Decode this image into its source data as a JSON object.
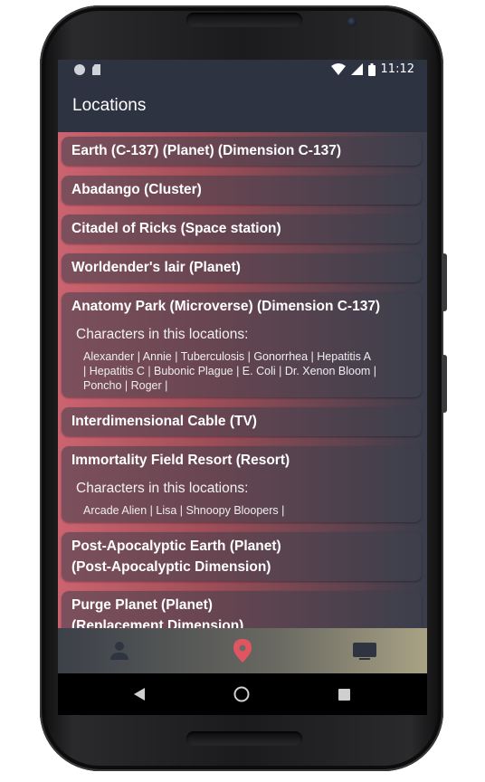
{
  "status_bar": {
    "time": "11:12"
  },
  "app_bar": {
    "title": "Locations"
  },
  "locations": [
    {
      "name": "Earth (C-137)  (Planet)  (Dimension C-137)"
    },
    {
      "name": "Abadango  (Cluster)"
    },
    {
      "name": "Citadel of Ricks  (Space station)"
    },
    {
      "name": "Worldender's lair  (Planet)"
    },
    {
      "name": "Anatomy Park  (Microverse)  (Dimension C-137)",
      "characters_heading": "Characters in this locations:",
      "characters_line1": "Alexander | Annie | Tuberculosis | Gonorrhea | Hepatitis A",
      "characters_line2": "| Hepatitis C | Bubonic Plague | E. Coli | Dr. Xenon Bloom |",
      "characters_line3": "Poncho | Roger |"
    },
    {
      "name": "Interdimensional Cable  (TV)"
    },
    {
      "name": "Immortality Field Resort  (Resort)",
      "characters_heading": "Characters in this locations:",
      "characters_line1": "Arcade Alien | Lisa | Shnoopy Bloopers |"
    },
    {
      "name_line1": "Post-Apocalyptic Earth  (Planet)",
      "name_line2": "(Post-Apocalyptic Dimension)"
    },
    {
      "name_line1": "Purge Planet  (Planet)",
      "name_line2": "(Replacement Dimension)"
    }
  ],
  "bottom_nav": {
    "items": [
      {
        "icon": "person-icon",
        "active": false
      },
      {
        "icon": "location-pin-icon",
        "active": true
      },
      {
        "icon": "tv-icon",
        "active": false
      }
    ],
    "active_color": "#e05561",
    "inactive_color": "#2f3441"
  }
}
